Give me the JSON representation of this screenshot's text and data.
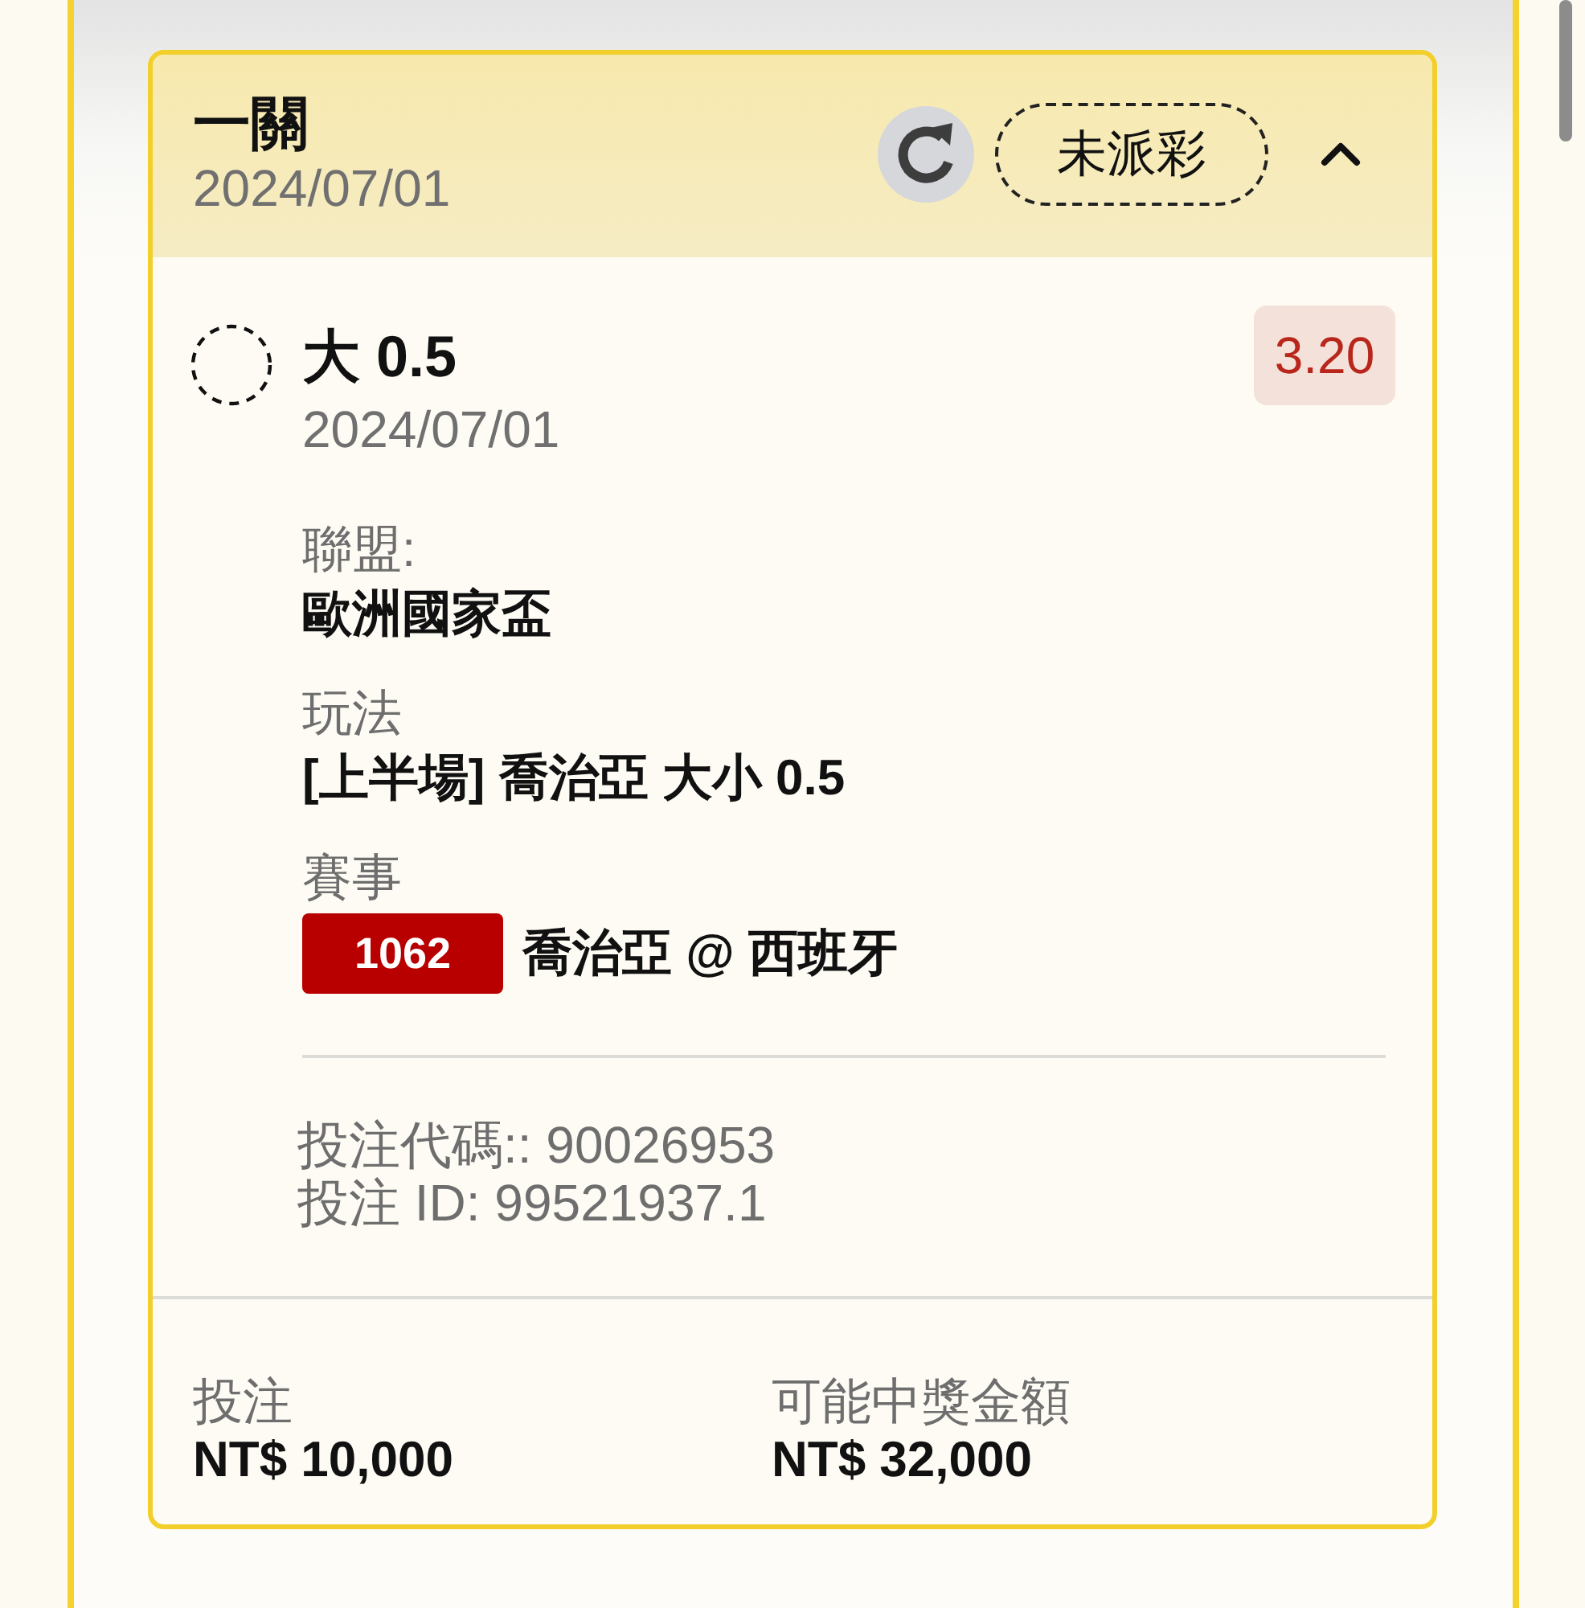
{
  "bet": {
    "title": "一關",
    "date": "2024/07/01",
    "status": "未派彩",
    "expanded": true
  },
  "selection": {
    "name": "大 0.5",
    "date": "2024/07/01",
    "odds": "3.20"
  },
  "details": [
    {
      "kind": "text",
      "label": "聯盟:",
      "value": "歐洲國家盃"
    },
    {
      "kind": "text",
      "label": "玩法",
      "value": "[上半場] 喬治亞 大小 0.5"
    },
    {
      "kind": "match",
      "label": "賽事",
      "match_code": "1062",
      "value": "喬治亞 @ 西班牙"
    }
  ],
  "references": [
    "投注代碼:: 90026953",
    "投注 ID: 99521937.1"
  ],
  "summary": [
    {
      "label": "投注",
      "value": "NT$ 10,000"
    },
    {
      "label": "可能中獎金額",
      "value": "NT$ 32,000"
    }
  ]
}
